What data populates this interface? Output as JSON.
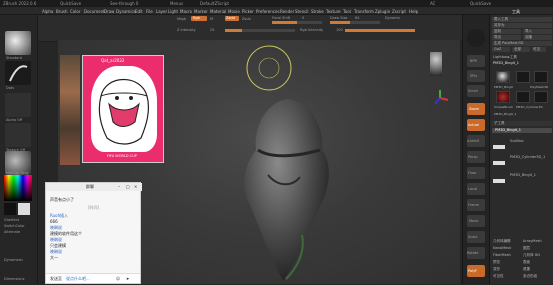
{
  "titlebar": {
    "segments": [
      "ZBrush 2022.0.6",
      "QuickSave",
      "See-through 0",
      "Menus",
      "DefaultZScript"
    ],
    "right": [
      "AC",
      "QuickSave"
    ]
  },
  "menubar": {
    "items": [
      "Alpha",
      "Brush",
      "Color",
      "Document",
      "Draw",
      "Dynamics",
      "Edit",
      "File",
      "Layer",
      "Light",
      "Macro",
      "Marker",
      "Material",
      "Movie",
      "Picker",
      "Preferences",
      "Render",
      "Stencil",
      "Stroke",
      "Texture",
      "Tool",
      "Transform",
      "Zplugin",
      "Zscript",
      "Help"
    ],
    "right_label": "工具"
  },
  "toolbar": {
    "mrgb": "Mrgb",
    "rgb": "Rgb",
    "m": "M",
    "zadd": "Zadd",
    "zsub": "Zsub",
    "focal_label": "Focal Shift",
    "focal_value": "0",
    "draw_label": "Draw Size",
    "draw_value": "64",
    "z_intensity_label": "Z Intensity",
    "z_intensity_value": "25",
    "rgb_intensity_label": "Rgb Intensity",
    "rgb_intensity_value": "100",
    "dynamic": "Dynamic"
  },
  "colors": {
    "accent": "#d07030",
    "poster": "#ec2d6d"
  },
  "left_shelf": {
    "labels": [
      "Standard",
      "Dots",
      "Alpha Off",
      "Texture Off",
      "MatCap Gray",
      "Gradient",
      "SwitchColor",
      "Alternate"
    ],
    "bottom": [
      "Dynamesh",
      "Dimensions"
    ]
  },
  "poster": {
    "title": "Qat_ar2022",
    "footer": "FIFA WORLD CUP"
  },
  "chat": {
    "title": "群聊",
    "lines": [
      {
        "text": "声音有点小了",
        "color": "dark"
      },
      {
        "text": "[时间]",
        "color": "dark"
      },
      {
        "text": "Ruoh插入",
        "color": "blue"
      },
      {
        "text": "666",
        "color": "dark"
      },
      {
        "text": "晓琳说",
        "color": "blue"
      },
      {
        "text": "建模的软件用这个",
        "color": "dark"
      },
      {
        "text": "晓琳说",
        "color": "blue"
      },
      {
        "text": "只会建模",
        "color": "dark"
      },
      {
        "text": "晓琳说",
        "color": "blue"
      },
      {
        "text": "大一",
        "color": "dark"
      }
    ],
    "input_label": "发送至",
    "input_placeholder": "说点什么吧..."
  },
  "right_tools": [
    "BPR",
    "SPix",
    "Scroll",
    "Zoom",
    "Actual",
    "AAHalf",
    "Persp",
    "Floor",
    "Local",
    "Frame",
    "Move",
    "Scale",
    "Rotate",
    "PolyF",
    "Transp",
    "Solo"
  ],
  "panel": {
    "title": "工具",
    "buttons": [
      "载入工具",
      "另存为",
      "复制",
      "导入",
      "导出",
      "克隆",
      "生成 PolyMesh3D",
      "GoZ",
      "全部",
      "可见",
      "R"
    ],
    "brush_label": "Lightbox▸工具",
    "current_tool": "PM3D_Bingit_1",
    "thumbs": [
      "PM3D_Bingit",
      "Cylinder3D",
      "PolyMesh3D",
      "SimpleBrush",
      "PM3D_Cylinder3D",
      "PM3D_Bingit_1"
    ],
    "subtool_header": "子工具",
    "subtools": [
      "PM3D_Bingit_1",
      "SubTool",
      "PM3D_Cylinder3D_1",
      "PM3D_Bingit_1"
    ],
    "bottom": [
      "几何体编辑",
      "ArrayMesh",
      "NanoMesh",
      "图层",
      "FiberMesh",
      "几何体 HD",
      "预览",
      "表面",
      "变形",
      "遮罩",
      "可见性",
      "多边形组"
    ]
  }
}
